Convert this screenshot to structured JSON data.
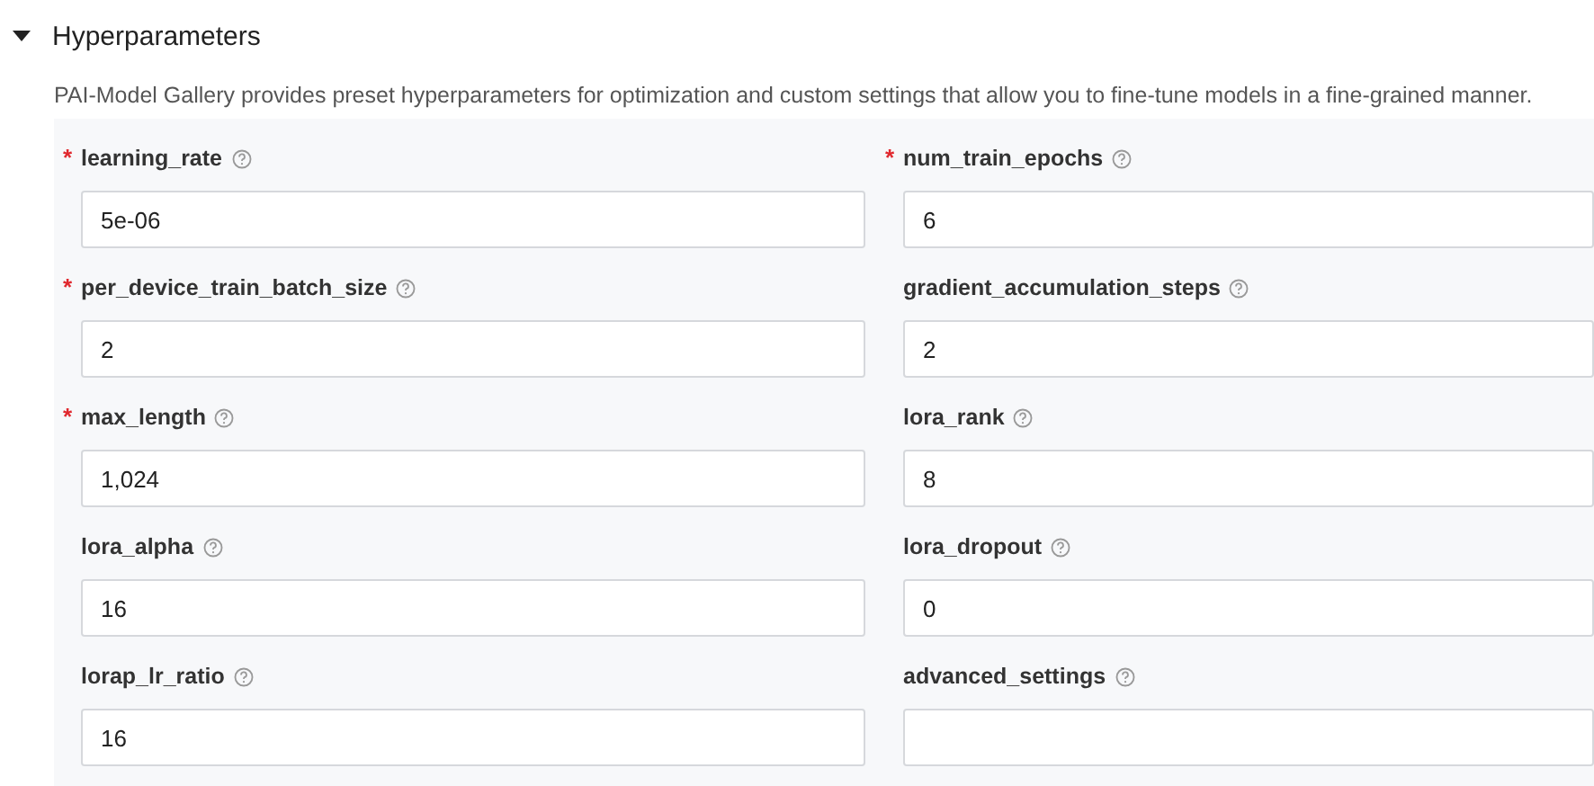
{
  "section": {
    "title": "Hyperparameters",
    "expanded": true,
    "description": "PAI-Model Gallery provides preset hyperparameters for optimization and custom settings that allow you to fine-tune models in a fine-grained manner."
  },
  "fields": [
    {
      "label": "learning_rate",
      "required_mark": "*",
      "value": "5e-06"
    },
    {
      "label": "num_train_epochs",
      "required_mark": "*",
      "value": "6"
    },
    {
      "label": "per_device_train_batch_size",
      "required_mark": "*",
      "value": "2"
    },
    {
      "label": "gradient_accumulation_steps",
      "value": "2"
    },
    {
      "label": "max_length",
      "required_mark": "*",
      "value": "1,024"
    },
    {
      "label": "lora_rank",
      "value": "8"
    },
    {
      "label": "lora_alpha",
      "value": "16"
    },
    {
      "label": "lora_dropout",
      "value": "0"
    },
    {
      "label": "lorap_lr_ratio",
      "value": "16"
    },
    {
      "label": "advanced_settings"
    }
  ]
}
